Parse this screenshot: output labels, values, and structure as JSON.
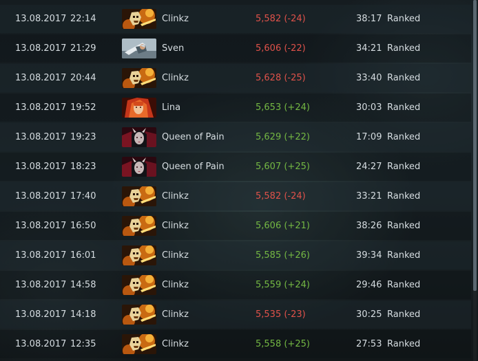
{
  "colors": {
    "loss": "#e0524a",
    "win": "#74b843"
  },
  "matches": [
    {
      "date": "13.08.2017",
      "time": "22:14",
      "hero": "Clinkz",
      "hero_icon": "clinkz-portrait",
      "mmr": "5,582 (-24)",
      "result": "loss",
      "duration": "38:17",
      "mode": "Ranked"
    },
    {
      "date": "13.08.2017",
      "time": "21:29",
      "hero": "Sven",
      "hero_icon": "sven-portrait",
      "mmr": "5,606 (-22)",
      "result": "loss",
      "duration": "34:21",
      "mode": "Ranked"
    },
    {
      "date": "13.08.2017",
      "time": "20:44",
      "hero": "Clinkz",
      "hero_icon": "clinkz-portrait",
      "mmr": "5,628 (-25)",
      "result": "loss",
      "duration": "33:40",
      "mode": "Ranked"
    },
    {
      "date": "13.08.2017",
      "time": "19:52",
      "hero": "Lina",
      "hero_icon": "lina-portrait",
      "mmr": "5,653 (+24)",
      "result": "win",
      "duration": "30:03",
      "mode": "Ranked"
    },
    {
      "date": "13.08.2017",
      "time": "19:23",
      "hero": "Queen of Pain",
      "hero_icon": "queen-of-pain-portrait",
      "mmr": "5,629 (+22)",
      "result": "win",
      "duration": "17:09",
      "mode": "Ranked"
    },
    {
      "date": "13.08.2017",
      "time": "18:23",
      "hero": "Queen of Pain",
      "hero_icon": "queen-of-pain-portrait",
      "mmr": "5,607 (+25)",
      "result": "win",
      "duration": "24:27",
      "mode": "Ranked"
    },
    {
      "date": "13.08.2017",
      "time": "17:40",
      "hero": "Clinkz",
      "hero_icon": "clinkz-portrait",
      "mmr": "5,582 (-24)",
      "result": "loss",
      "duration": "33:21",
      "mode": "Ranked"
    },
    {
      "date": "13.08.2017",
      "time": "16:50",
      "hero": "Clinkz",
      "hero_icon": "clinkz-portrait",
      "mmr": "5,606 (+21)",
      "result": "win",
      "duration": "38:26",
      "mode": "Ranked"
    },
    {
      "date": "13.08.2017",
      "time": "16:01",
      "hero": "Clinkz",
      "hero_icon": "clinkz-portrait",
      "mmr": "5,585 (+26)",
      "result": "win",
      "duration": "39:34",
      "mode": "Ranked"
    },
    {
      "date": "13.08.2017",
      "time": "14:58",
      "hero": "Clinkz",
      "hero_icon": "clinkz-portrait",
      "mmr": "5,559 (+24)",
      "result": "win",
      "duration": "29:46",
      "mode": "Ranked"
    },
    {
      "date": "13.08.2017",
      "time": "14:18",
      "hero": "Clinkz",
      "hero_icon": "clinkz-portrait",
      "mmr": "5,535 (-23)",
      "result": "loss",
      "duration": "30:25",
      "mode": "Ranked"
    },
    {
      "date": "13.08.2017",
      "time": "12:35",
      "hero": "Clinkz",
      "hero_icon": "clinkz-portrait",
      "mmr": "5,558 (+25)",
      "result": "win",
      "duration": "27:53",
      "mode": "Ranked"
    }
  ]
}
